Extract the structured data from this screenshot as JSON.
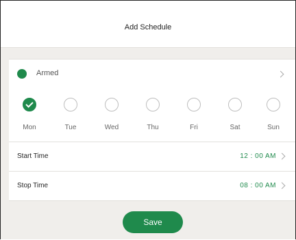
{
  "title": "Add Schedule",
  "mode": {
    "label": "Armed",
    "color": "#1f8a4c"
  },
  "days": [
    {
      "label": "Mon",
      "checked": true
    },
    {
      "label": "Tue",
      "checked": false
    },
    {
      "label": "Wed",
      "checked": false
    },
    {
      "label": "Thu",
      "checked": false
    },
    {
      "label": "Fri",
      "checked": false
    },
    {
      "label": "Sat",
      "checked": false
    },
    {
      "label": "Sun",
      "checked": false
    }
  ],
  "start": {
    "label": "Start Time",
    "value": "12 : 00 AM"
  },
  "stop": {
    "label": "Stop Time",
    "value": "08 : 00 AM"
  },
  "save_label": "Save",
  "colors": {
    "accent": "#1f8a4c",
    "background": "#f0eeeb"
  },
  "icons": {
    "mode_indicator": "status-dot-icon",
    "disclosure": "chevron-right-icon",
    "selected": "checkmark-icon"
  }
}
